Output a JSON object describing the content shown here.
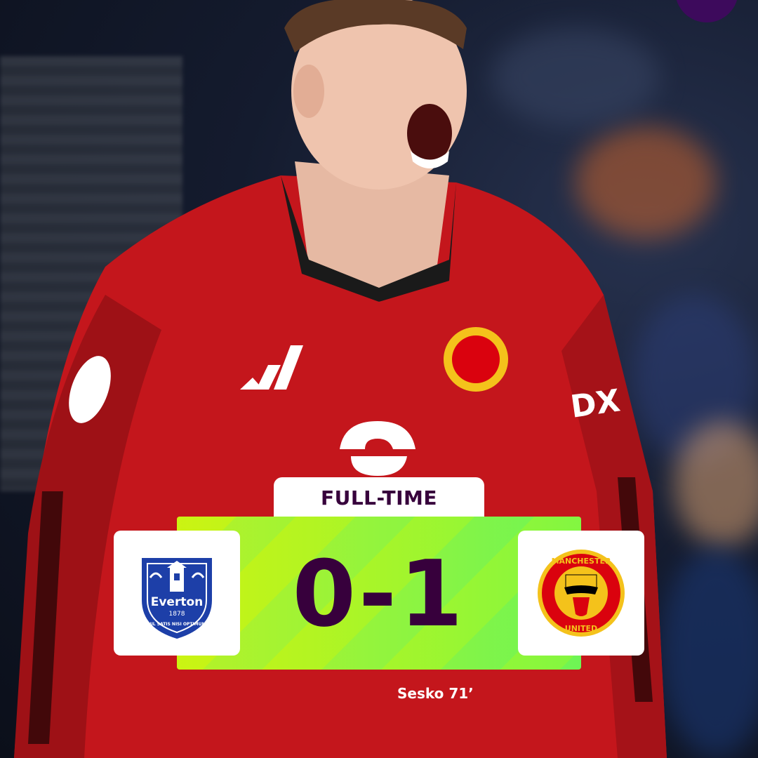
{
  "match": {
    "status": "FULL-TIME",
    "score": "0-1",
    "home_team": {
      "name": "Everton",
      "crest_text": "Everton",
      "founded": "1878",
      "motto": "NIL SATIS NISI OPTIMUM",
      "crest_color": "#1d3fa8"
    },
    "away_team": {
      "name": "Manchester United",
      "crest_top": "MANCHESTER",
      "crest_bottom": "UNITED",
      "crest_color": "#da020e"
    },
    "scorers": "Sesko 71’"
  },
  "colors": {
    "primary": "#37003c",
    "accent_lime": "#c8f21c",
    "accent_green": "#00ff87",
    "kit_red": "#c4161c"
  },
  "icons": [
    "premier-league-logo-icon",
    "everton-crest-icon",
    "manchester-united-crest-icon"
  ]
}
